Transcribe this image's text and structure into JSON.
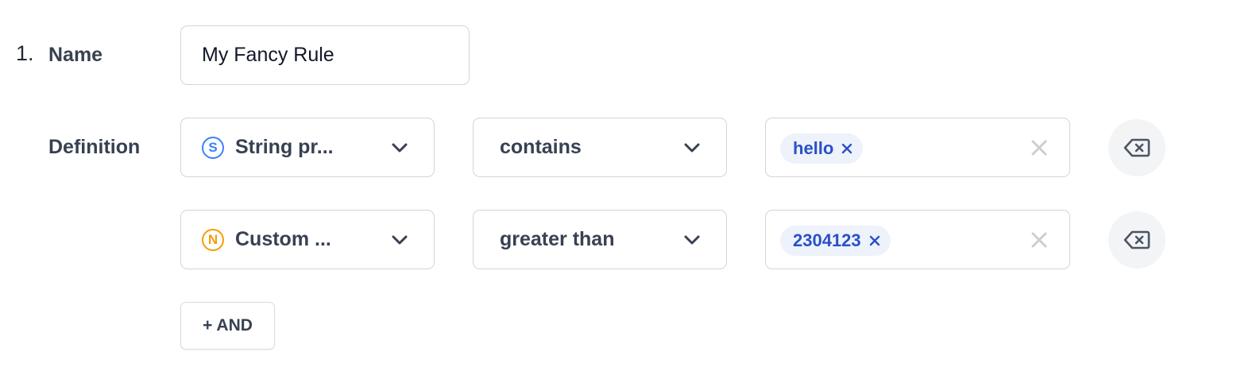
{
  "rule": {
    "number": "1.",
    "name_label": "Name",
    "name_value": "My Fancy Rule",
    "definition_label": "Definition"
  },
  "conditions": [
    {
      "property_type_badge": "S",
      "property_type_icon": "string-type-icon",
      "property_label": "String pr...",
      "operator_label": "contains",
      "values": [
        "hello"
      ]
    },
    {
      "property_type_badge": "N",
      "property_type_icon": "number-type-icon",
      "property_label": "Custom ...",
      "operator_label": "greater than",
      "values": [
        "2304123"
      ]
    }
  ],
  "and_button_label": "+ AND",
  "icons": {
    "dropdown": "chevron-down-icon",
    "remove_value": "close-icon",
    "clear_values": "clear-icon",
    "delete_condition": "backspace-icon"
  },
  "colors": {
    "string_badge": "#3b82f6",
    "number_badge": "#f59e0b",
    "chip_bg": "#eef2fb",
    "chip_text": "#2b50c7",
    "border": "#d1d5db"
  }
}
